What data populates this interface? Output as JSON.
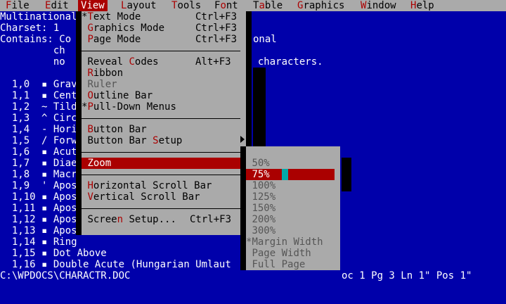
{
  "menubar": [
    "File",
    "Edit",
    "View",
    "Layout",
    "Tools",
    "Font",
    "Table",
    "Graphics",
    "Window",
    "Help"
  ],
  "doc_header": {
    "line1": "Multinational",
    "line2": "Charset: 1",
    "line3a": "Contains: Co",
    "line3b": "onal",
    "line4": "         ch",
    "line5a": "         no",
    "line5b": "l characters."
  },
  "rows": [
    {
      "code": "  1,0 ",
      "glyph": "▪",
      "name": " Grav"
    },
    {
      "code": "  1,1 ",
      "glyph": "▪",
      "name": " Cent"
    },
    {
      "code": "  1,2 ",
      "glyph": "~",
      "name": " Tild"
    },
    {
      "code": "  1,3 ",
      "glyph": "^",
      "name": " Circ"
    },
    {
      "code": "  1,4 ",
      "glyph": "-",
      "name": " Hori"
    },
    {
      "code": "  1,5 ",
      "glyph": "/",
      "name": " Forw"
    },
    {
      "code": "  1,6 ",
      "glyph": "▪",
      "name": " Acut"
    },
    {
      "code": "  1,7 ",
      "glyph": "▪",
      "name": " Diae"
    },
    {
      "code": "  1,8 ",
      "glyph": "▪",
      "name": " Macr"
    },
    {
      "code": "  1,9 ",
      "glyph": "'",
      "name": " Apos"
    },
    {
      "code": "  1,10",
      "glyph": "▪",
      "name": " Apos"
    },
    {
      "code": "  1,11",
      "glyph": "▪",
      "name": " Apos"
    },
    {
      "code": "  1,12",
      "glyph": "▪",
      "name": " Apos"
    },
    {
      "code": "  1,13",
      "glyph": "▪",
      "name": " Apos"
    },
    {
      "code": "  1,14",
      "glyph": "▪",
      "name": " Ring"
    },
    {
      "code": "  1,15",
      "glyph": "▪",
      "name": " Dot Above"
    },
    {
      "code": "  1,16",
      "glyph": "▪",
      "name": " Double Acute (Hungarian Umlaut"
    }
  ],
  "status": {
    "path": "C:\\WPDOCS\\CHARACTR.DOC",
    "right": "oc 1 Pg 3 Ln 1\" Pos 1\""
  },
  "view_menu": {
    "text_mode": {
      "mark": "*",
      "pre": "",
      "hk": "T",
      "post": "ext Mode",
      "shortcut": "Ctrl+F3"
    },
    "graphics_mode": {
      "mark": " ",
      "pre": "",
      "hk": "G",
      "post": "raphics Mode",
      "shortcut": "Ctrl+F3"
    },
    "page_mode": {
      "mark": " ",
      "pre": "",
      "hk": "P",
      "post": "age Mode",
      "shortcut": "Ctrl+F3"
    },
    "reveal_codes": {
      "mark": " ",
      "pre": "Reveal ",
      "hk": "C",
      "post": "odes",
      "shortcut": "Alt+F3"
    },
    "ribbon": {
      "mark": " ",
      "pre": "",
      "hk": "R",
      "post": "ibbon"
    },
    "ruler": {
      "mark": " ",
      "text": "Ruler"
    },
    "outline_bar": {
      "mark": " ",
      "pre": "",
      "hk": "O",
      "post": "utline Bar"
    },
    "pull_down": {
      "mark": "*",
      "pre": "",
      "hk": "P",
      "post": "ull-Down Menus"
    },
    "button_bar": {
      "mark": " ",
      "pre": "",
      "hk": "B",
      "post": "utton Bar"
    },
    "button_bar_setup": {
      "mark": " ",
      "pre": "Button Bar ",
      "hk": "S",
      "post": "etup"
    },
    "zoom": {
      "mark": " ",
      "pre": "",
      "hk": "Z",
      "post": "oom"
    },
    "h_scroll": {
      "mark": " ",
      "pre": "",
      "hk": "H",
      "post": "orizontal Scroll Bar"
    },
    "v_scroll": {
      "mark": " ",
      "pre": "",
      "hk": "V",
      "post": "ertical Scroll Bar"
    },
    "screen_setup": {
      "mark": " ",
      "pre": "Scree",
      "hk": "n",
      "post": " Setup...",
      "shortcut": "Ctrl+F3"
    }
  },
  "zoom_menu": [
    {
      "label": "50%",
      "mark": " "
    },
    {
      "label": "75%",
      "mark": " "
    },
    {
      "label": "100%",
      "mark": " "
    },
    {
      "label": "125%",
      "mark": " "
    },
    {
      "label": "150%",
      "mark": " "
    },
    {
      "label": "200%",
      "mark": " "
    },
    {
      "label": "300%",
      "mark": " "
    },
    {
      "label": "Margin Width",
      "mark": "*"
    },
    {
      "label": "Page Width",
      "mark": " "
    },
    {
      "label": "Full Page",
      "mark": " "
    }
  ],
  "colors": {
    "accent": "#aa0000",
    "menu_bg": "#aaaaaa",
    "doc_bg": "#0000aa",
    "cursor": "#00aaaa"
  }
}
